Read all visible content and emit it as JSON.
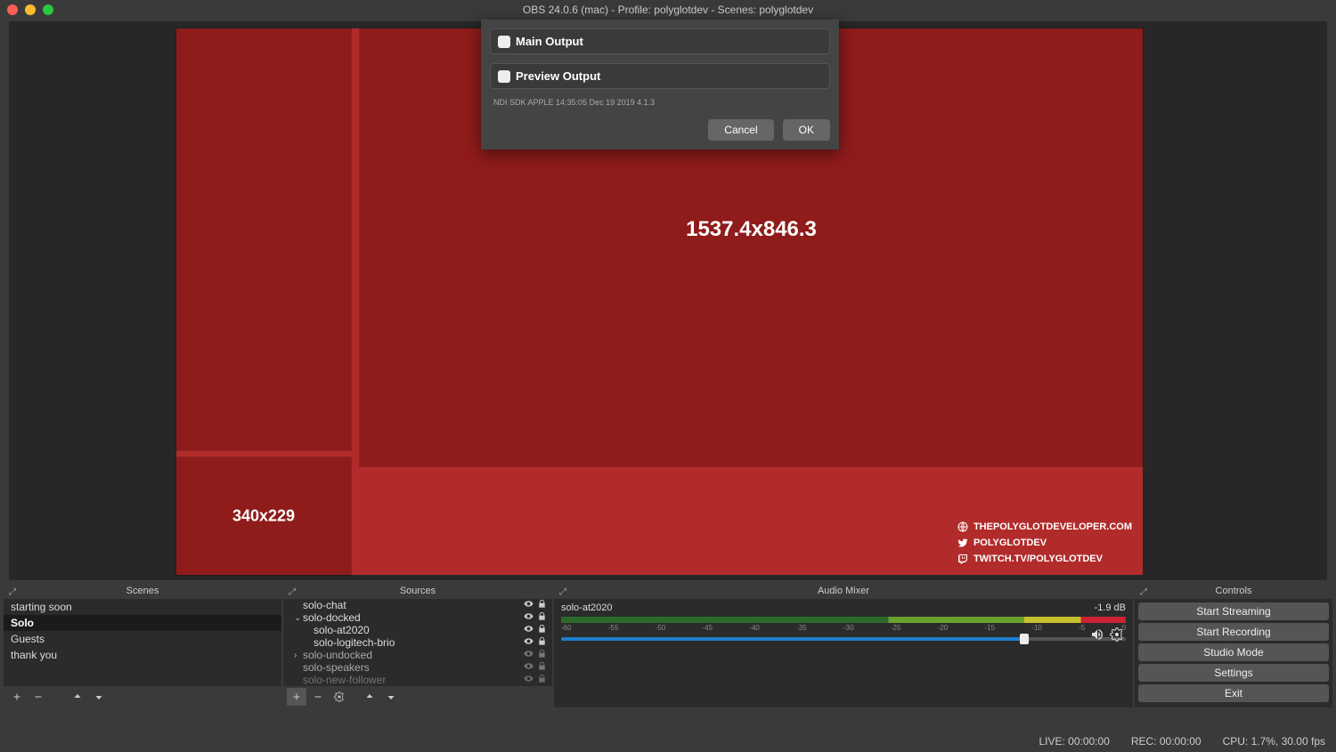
{
  "title": "OBS 24.0.6 (mac) - Profile: polyglotdev - Scenes: polyglotdev",
  "canvas": {
    "main_dim": "1537.4x846.3",
    "small_dim": "340x229",
    "social": [
      {
        "icon": "globe",
        "text": "THEPOLYGLOTDEVELOPER.COM"
      },
      {
        "icon": "twitter",
        "text": "POLYGLOTDEV"
      },
      {
        "icon": "twitch",
        "text": "TWITCH.TV/POLYGLOTDEV"
      }
    ]
  },
  "panels": {
    "scenes_title": "Scenes",
    "sources_title": "Sources",
    "mixer_title": "Audio Mixer",
    "controls_title": "Controls"
  },
  "scenes": [
    {
      "name": "starting soon"
    },
    {
      "name": "Solo",
      "selected": true
    },
    {
      "name": "Guests"
    },
    {
      "name": "thank you"
    }
  ],
  "sources": [
    {
      "name": "solo-chat",
      "indent": 0
    },
    {
      "name": "solo-docked",
      "indent": 0,
      "expanded": true
    },
    {
      "name": "solo-at2020",
      "indent": 1
    },
    {
      "name": "solo-logitech-brio",
      "indent": 1
    },
    {
      "name": "solo-undocked",
      "indent": 0,
      "collapsed": true,
      "dim": true
    },
    {
      "name": "solo-speakers",
      "indent": 0,
      "dim": true
    },
    {
      "name": "solo-new-follower",
      "indent": 0,
      "cut": true
    }
  ],
  "mixer": {
    "channel": "solo-at2020",
    "db": "-1.9 dB",
    "ticks": [
      "-60",
      "-55",
      "-50",
      "-45",
      "-40",
      "-35",
      "-30",
      "-25",
      "-20",
      "-15",
      "-10",
      "-5",
      "0"
    ]
  },
  "controls": [
    "Start Streaming",
    "Start Recording",
    "Studio Mode",
    "Settings",
    "Exit"
  ],
  "status": {
    "live": "LIVE: 00:00:00",
    "rec": "REC: 00:00:00",
    "cpu": "CPU: 1.7%, 30.00 fps"
  },
  "modal": {
    "main": "Main Output",
    "preview": "Preview Output",
    "note": "NDI SDK APPLE 14:35:05 Dec 19 2019 4.1.3",
    "cancel": "Cancel",
    "ok": "OK"
  }
}
